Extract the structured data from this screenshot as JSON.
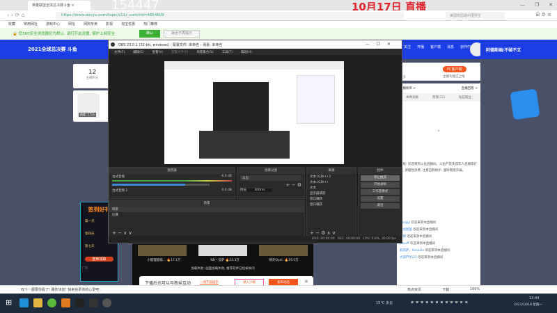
{
  "overlay": {
    "number": "154447",
    "date": "10月17日 直播"
  },
  "browser": {
    "tab_title": "英雄联盟全球总决赛斗鱼",
    "url": "https://www.douyu.com/topic/s11z_com/rid=4654609",
    "search_placeholder": "美国校园遇中国学生",
    "bookmarks": [
      "收藏",
      "常用网址",
      "游戏中心",
      "网址",
      "网购专卖",
      "影视",
      "淘宝优惠",
      "热门推荐"
    ],
    "notice": "您360安全浏览器仍为默认, 请打开此设置, 保护上网安全",
    "notice_ok": "确认",
    "notice_dismiss": "最近不再提示",
    "status_text": "双十一都要你看了! 路你决定! 快来投票你的心爱吧..",
    "status_right": [
      "热点资讯",
      "下载",
      "100%"
    ]
  },
  "douyu": {
    "logo_text": "2021全球总决赛 斗鱼",
    "nav": [
      "关注",
      "开播",
      "客户端",
      "消息",
      "创作中心"
    ],
    "username": "阿德斯缅/不破不立",
    "score_value": "12",
    "score_label": "主播积分",
    "avatar_caption": "热度: 1.5万",
    "more_label": "更多",
    "pc_client": "PC客户端",
    "pc_client_sub": "主播功能已上线",
    "rank_links": [
      "主播榜单 >",
      "直播回看 >"
    ],
    "tabs": [
      "本周贡献",
      "贵宾(11)",
      "钻石粉丝"
    ],
    "promo": {
      "title": "签到好礼",
      "days": [
        "第一天",
        "第四天",
        "第七天"
      ],
      "button": "签到领取",
      "ad": "广告"
    },
    "chat_notice": "系统: 欢迎来到斗鱼直播间。斗鱼严禁未成年人直播或打赏, 请理性消费, 注意自我保护, 谨防网络诈骗。",
    "chat": [
      {
        "user": "liangyl",
        "msg": "欢迎来到本直播间"
      },
      {
        "user": "恐龙图鉴",
        "msg": "欢迎来到本直播间"
      },
      {
        "user": "陈律",
        "msg": "欢迎来到本直播间"
      },
      {
        "user": "Jiaoxff",
        "msg": "欢迎来到本直播间"
      },
      {
        "user": "莉莉萨、KesaLie",
        "msg": "欢迎来到本直播间"
      },
      {
        "user": "大葫芦9521",
        "msg": "欢迎来到本直播间"
      }
    ],
    "recommend": [
      {
        "name": "小狐狸超级...",
        "heat": "17.1万"
      },
      {
        "name": "NB丶莹萨",
        "heat": "23.3万"
      },
      {
        "name": "晴天Qyal.",
        "heat": "19.5万"
      }
    ],
    "load_fail": "加载失败: 画面加载失败, 推荐软件已经被关闭",
    "popup": {
      "text": "下播后也可以与粉丝互动",
      "link": "一周不再提示",
      "join": "进入小组",
      "post": "发布动态"
    }
  },
  "obs": {
    "title": "OBS 23.0.1 (32-bit, windows) - 配置文件: 未命名 - 场景: 未命名",
    "menu": [
      "文件(F)",
      "编辑(E)",
      "查看(V)",
      "配置文件(P)",
      "场景集合(S)",
      "工具(T)",
      "帮助(H)"
    ],
    "mixer": {
      "title": "混音器",
      "tracks": [
        {
          "name": "台式音频",
          "db": "-6.0 dB"
        },
        {
          "name": "台式音频 2",
          "db": "0.0 dB"
        }
      ],
      "volume": 0.75
    },
    "transitions": {
      "title": "场景过渡",
      "type": "淡出",
      "duration_label": "时长",
      "duration": "300ms"
    },
    "scenes": {
      "title": "场景",
      "items": [
        "场景",
        "比赛"
      ]
    },
    "sources": {
      "title": "来源",
      "items": [
        "文本 (GDI+) 2",
        "文本 (GDI+)",
        "文本",
        "显示器捕获",
        "窗口捕获",
        "窗口捕获"
      ]
    },
    "controls": {
      "title": "控件",
      "buttons": [
        "停止推流",
        "开始录制",
        "工作室模式",
        "设置",
        "退出"
      ]
    },
    "status": {
      "live": "LIVE: 00:00:00",
      "rec": "REC: 00:00:00",
      "cpu": "CPU: 0.0%, 30.00 fps"
    }
  },
  "taskbar": {
    "weather": "15°C 多云",
    "time": "13:44",
    "date": "2021/10/18 星期一"
  }
}
